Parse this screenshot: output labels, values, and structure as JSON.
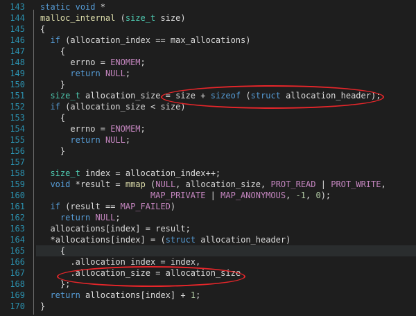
{
  "editor": {
    "lines": [
      {
        "n": "143",
        "text": "static void *"
      },
      {
        "n": "144",
        "text": "malloc_internal (size_t size)"
      },
      {
        "n": "145",
        "text": "{"
      },
      {
        "n": "146",
        "text": "  if (allocation_index == max_allocations)"
      },
      {
        "n": "147",
        "text": "    {"
      },
      {
        "n": "148",
        "text": "      errno = ENOMEM;"
      },
      {
        "n": "149",
        "text": "      return NULL;"
      },
      {
        "n": "150",
        "text": "    }"
      },
      {
        "n": "151",
        "text": "  size_t allocation_size = size + sizeof (struct allocation_header);"
      },
      {
        "n": "152",
        "text": "  if (allocation_size < size)"
      },
      {
        "n": "153",
        "text": "    {"
      },
      {
        "n": "154",
        "text": "      errno = ENOMEM;"
      },
      {
        "n": "155",
        "text": "      return NULL;"
      },
      {
        "n": "156",
        "text": "    }"
      },
      {
        "n": "157",
        "text": ""
      },
      {
        "n": "158",
        "text": "  size_t index = allocation_index++;"
      },
      {
        "n": "159",
        "text": "  void *result = mmap (NULL, allocation_size, PROT_READ | PROT_WRITE,"
      },
      {
        "n": "160",
        "text": "                      MAP_PRIVATE | MAP_ANONYMOUS, -1, 0);"
      },
      {
        "n": "161",
        "text": "  if (result == MAP_FAILED)"
      },
      {
        "n": "162",
        "text": "    return NULL;"
      },
      {
        "n": "163",
        "text": "  allocations[index] = result;"
      },
      {
        "n": "164",
        "text": "  *allocations[index] = (struct allocation_header)"
      },
      {
        "n": "165",
        "text": "    {"
      },
      {
        "n": "166",
        "text": "      .allocation_index = index,"
      },
      {
        "n": "167",
        "text": "      .allocation_size = allocation_size"
      },
      {
        "n": "168",
        "text": "    };"
      },
      {
        "n": "169",
        "text": "  return allocations[index] + 1;"
      },
      {
        "n": "170",
        "text": "}"
      }
    ]
  },
  "colors": {
    "background": "#1e1e1e",
    "line_number": "#2b91af",
    "keyword": "#569cd6",
    "type": "#4ec9b0",
    "function": "#dcdcaa",
    "macro": "#c586c0",
    "annotation": "#e8262a"
  }
}
